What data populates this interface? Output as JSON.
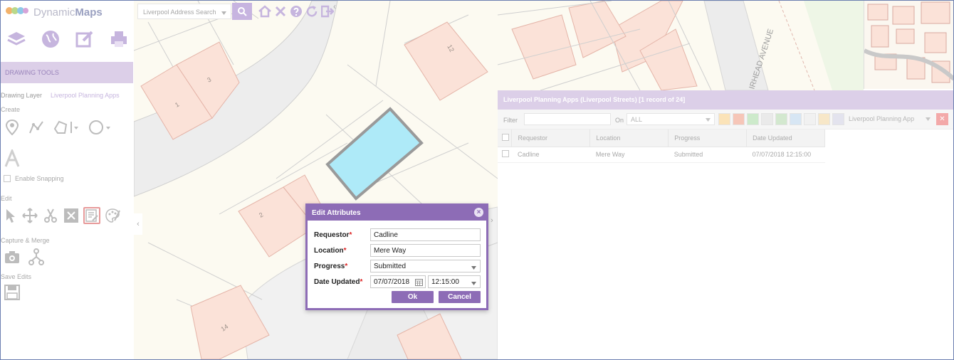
{
  "app": {
    "brand_plain": "Dynamic",
    "brand_bold": "Maps"
  },
  "search": {
    "placeholder": "Liverpool Address Search"
  },
  "sidebar": {
    "section_title": "DRAWING TOOLS",
    "tabs": [
      "Drawing Layer",
      "Liverpool Planning Apps"
    ],
    "create_label": "Create",
    "snapping_label": "Enable Snapping",
    "edit_label": "Edit",
    "capture_label": "Capture & Merge",
    "save_label": "Save Edits"
  },
  "map": {
    "parcel_labels": [
      "1",
      "3",
      "12",
      "2",
      "14"
    ],
    "street_label": "IRHEAD AVENUE"
  },
  "grid": {
    "title": "Liverpool Planning Apps (Liverpool Streets) [1 record of 24]",
    "filter_label": "Filter",
    "on_label": "On",
    "on_value": "ALL",
    "layer_value": "Liverpool Planning App",
    "columns": [
      "Requestor",
      "Location",
      "Progress",
      "Date Updated"
    ],
    "rows": [
      {
        "requestor": "Cadline",
        "location": "Mere Way",
        "progress": "Submitted",
        "date_updated": "07/07/2018 12:15:00"
      }
    ]
  },
  "dialog": {
    "title": "Edit Attributes",
    "fields": {
      "requestor": {
        "label": "Requestor",
        "value": "Cadline"
      },
      "location": {
        "label": "Location",
        "value": "Mere Way"
      },
      "progress": {
        "label": "Progress",
        "value": "Submitted"
      },
      "date_updated": {
        "label": "Date Updated",
        "date": "07/07/2018",
        "time": "12:15:00"
      }
    },
    "required_mark": "*",
    "ok_label": "Ok",
    "cancel_label": "Cancel"
  },
  "colors": {
    "accent": "#8d6cb6",
    "header_tint": "#dccfe8",
    "selection_fill": "#aeeaf8"
  }
}
